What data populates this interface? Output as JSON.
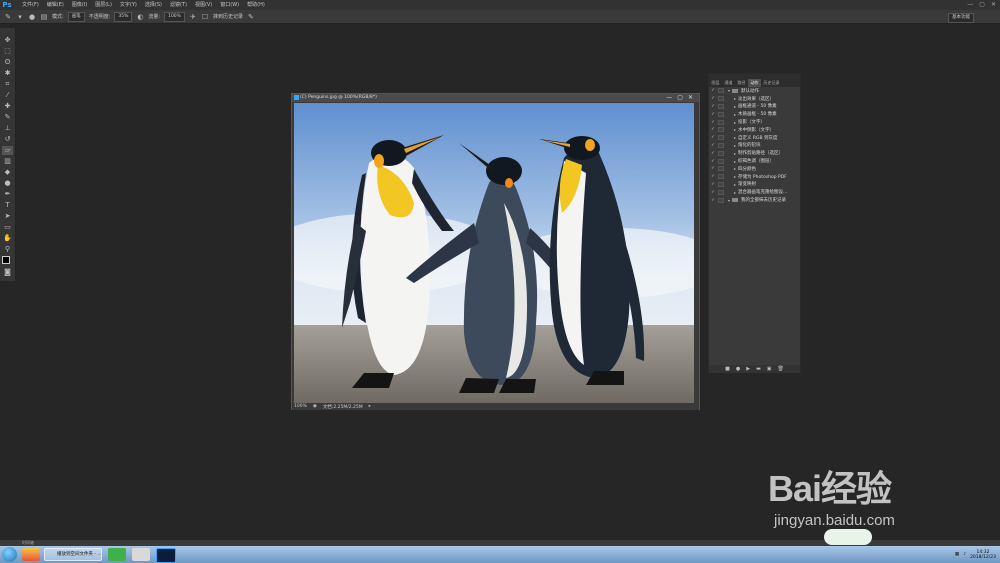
{
  "app": {
    "logo": "Ps"
  },
  "menu": [
    "文件(F)",
    "编辑(E)",
    "图像(I)",
    "图层(L)",
    "文字(Y)",
    "选择(S)",
    "滤镜(T)",
    "视图(V)",
    "窗口(W)",
    "帮助(H)"
  ],
  "window_controls": [
    "—",
    "▢",
    "✕"
  ],
  "options_bar": {
    "mode_label": "模式:",
    "mode_value": "画笔",
    "opacity_label": "不透明度:",
    "opacity_value": "35%",
    "flow_label": "流量:",
    "flow_value": "100%",
    "erase_history_label": "抹到历史记录",
    "workspace": "基本功能"
  },
  "document": {
    "title": "(C) Penguins.jpg @ 100%(RGB/8*)",
    "zoom": "100%",
    "doc_info": "文档:2.25M/2.25M"
  },
  "panel": {
    "tabs": [
      "图层",
      "通道",
      "路径",
      "动作",
      "历史记录"
    ],
    "active_tab": "动作",
    "actions": [
      {
        "label": "默认动作",
        "type": "set"
      },
      {
        "label": "淡出效果（选区）",
        "type": "item"
      },
      {
        "label": "画框通道 - 50 像素",
        "type": "item"
      },
      {
        "label": "木质画框 - 50 像素",
        "type": "item"
      },
      {
        "label": "投影（文字）",
        "type": "item"
      },
      {
        "label": "水中倒影（文字）",
        "type": "item"
      },
      {
        "label": "自定义 RGB 到灰度",
        "type": "item"
      },
      {
        "label": "熔化的铅块",
        "type": "item"
      },
      {
        "label": "制作剪贴路径（选区）",
        "type": "item"
      },
      {
        "label": "棕褐色调（图层）",
        "type": "item"
      },
      {
        "label": "四分颜色",
        "type": "item"
      },
      {
        "label": "存储为 Photoshop PDF",
        "type": "item"
      },
      {
        "label": "渐变映射",
        "type": "item"
      },
      {
        "label": "混合器画笔克隆绘图设...",
        "type": "item"
      },
      {
        "label": "我的全部抹去历史记录",
        "type": "set"
      }
    ]
  },
  "timeline": {
    "label": "时间轴"
  },
  "taskbar": {
    "items": [
      "播放到空间文件夹 - ..."
    ],
    "clock_time": "14:32",
    "clock_date": "2018/12/23"
  },
  "watermark": {
    "brand": "Bai经验",
    "url": "jingyan.baidu.com"
  },
  "colors": {
    "ps_blue": "#31a8ff",
    "workspace_bg": "#262626",
    "panel_bg": "#3a3a3a"
  }
}
